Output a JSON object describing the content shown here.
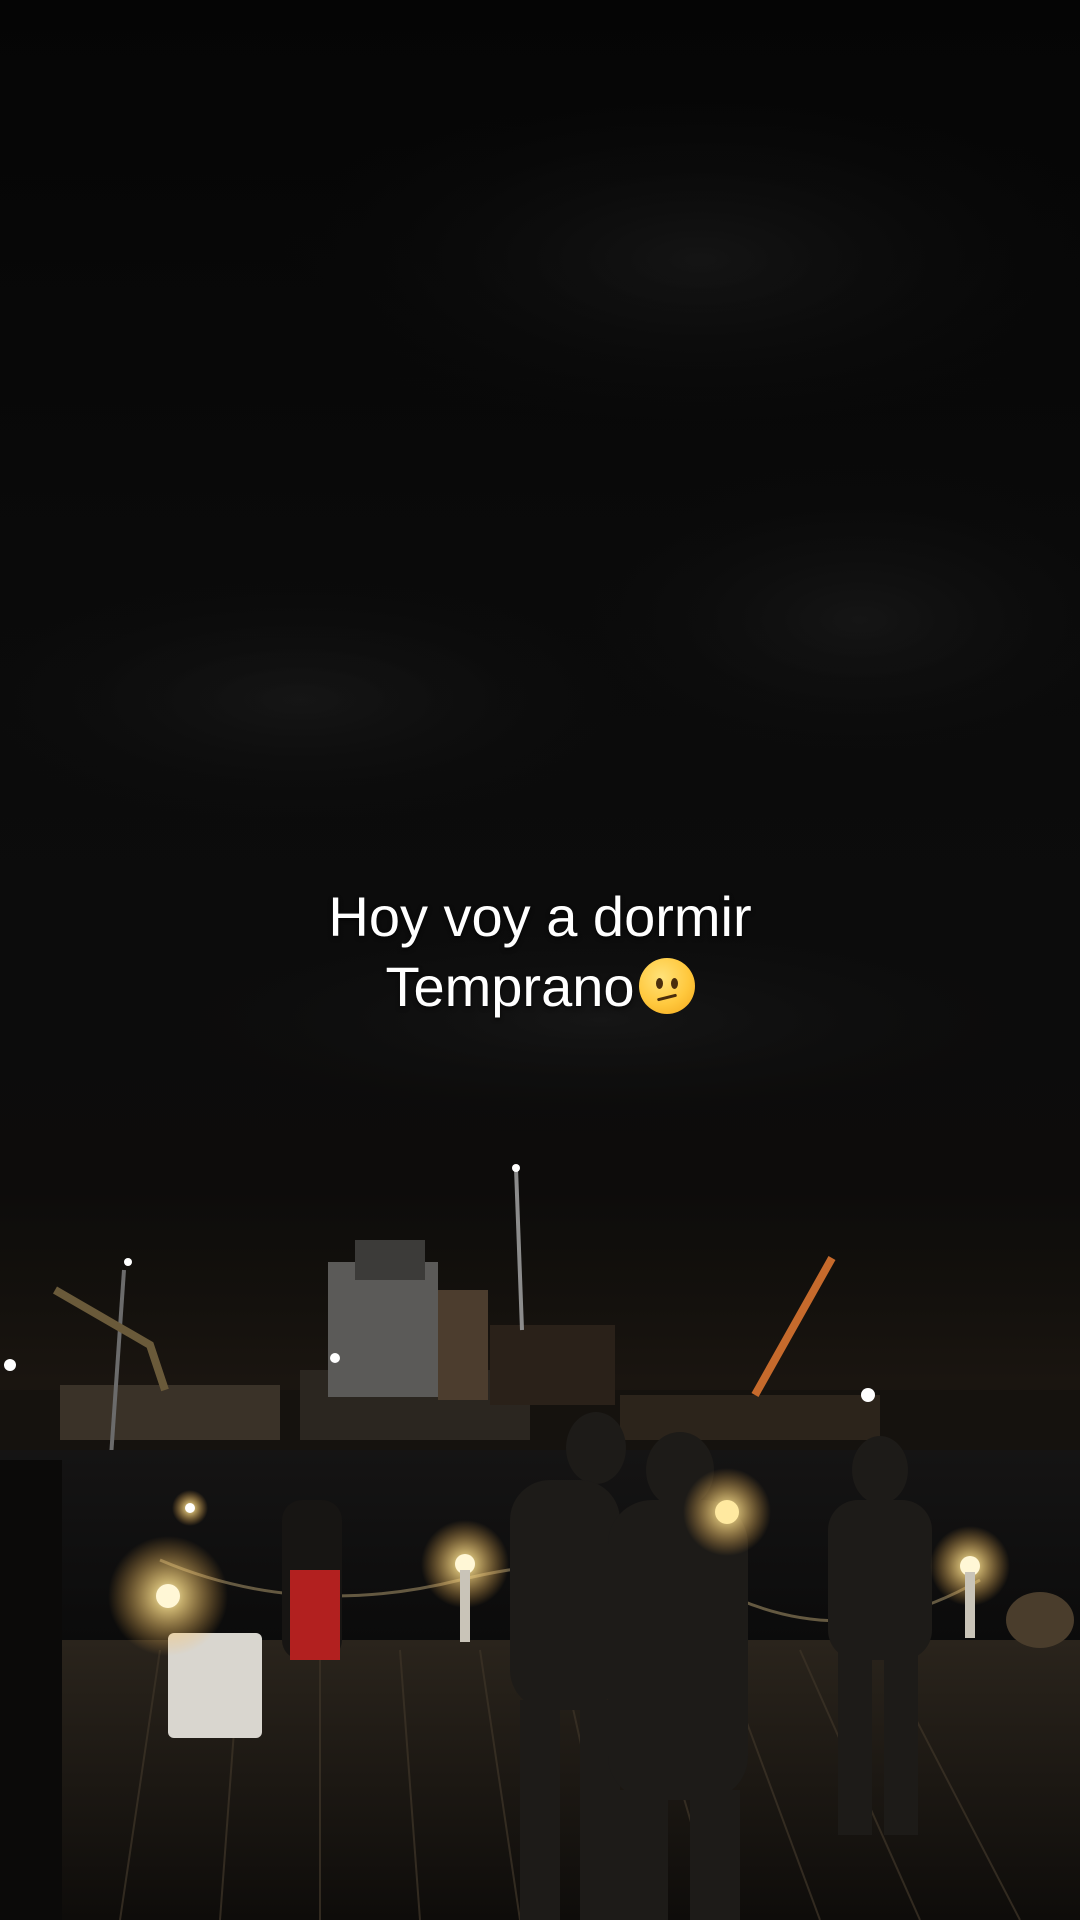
{
  "caption": {
    "line1": "Hoy voy a dormir",
    "line2": "Temprano",
    "emoji_icon": "confused-face-icon"
  },
  "colors": {
    "caption_text": "#ffffff",
    "sky": "#0a0a0a",
    "light_glow": "#fff3b0"
  }
}
